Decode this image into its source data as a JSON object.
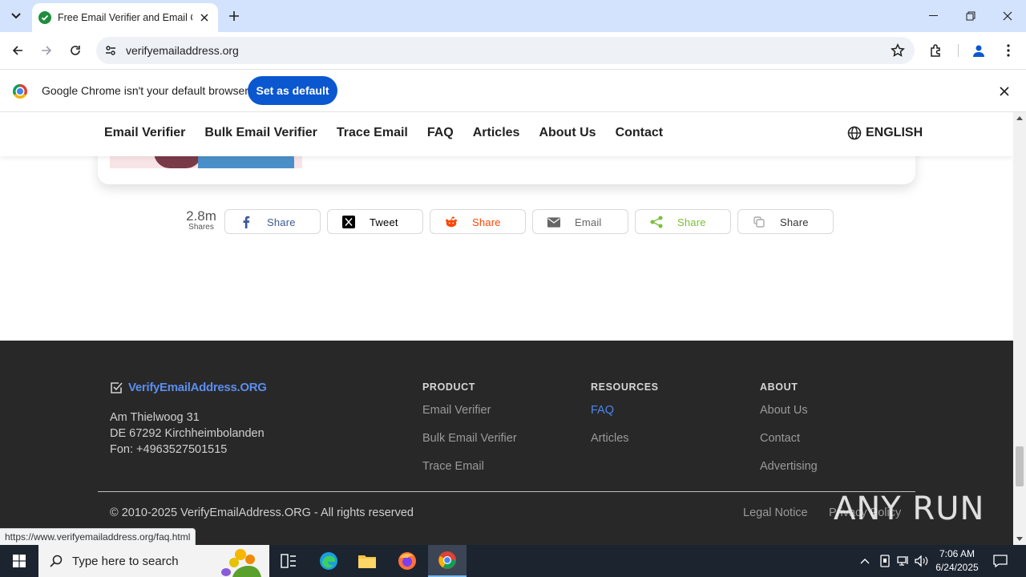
{
  "browser": {
    "tab_title": "Free Email Verifier and Email Ch",
    "url": "verifyemailaddress.org",
    "status_url": "https://www.verifyemailaddress.org/faq.html"
  },
  "infobar": {
    "message": "Google Chrome isn't your default browser",
    "button": "Set as default"
  },
  "nav": {
    "items": [
      "Email Verifier",
      "Bulk Email Verifier",
      "Trace Email",
      "FAQ",
      "Articles",
      "About Us",
      "Contact"
    ],
    "language": "ENGLISH"
  },
  "share": {
    "count": "2.8m",
    "caption": "Shares",
    "buttons": [
      {
        "label": "Share",
        "icon": "facebook-icon",
        "color": "#3b5998"
      },
      {
        "label": "Tweet",
        "icon": "x-icon",
        "color": "#000000"
      },
      {
        "label": "Share",
        "icon": "reddit-icon",
        "color": "#ff4500"
      },
      {
        "label": "Email",
        "icon": "email-icon",
        "color": "#666666"
      },
      {
        "label": "Share",
        "icon": "share-icon",
        "color": "#7bbf3a"
      },
      {
        "label": "Share",
        "icon": "copy-icon",
        "color": "#aaaaaa"
      }
    ]
  },
  "footer": {
    "brand": "VerifyEmailAddress.ORG",
    "address": [
      "Am Thielwoog 31",
      "DE 67292 Kirchheimbolanden",
      "Fon: +4963527501515"
    ],
    "columns": [
      {
        "heading": "PRODUCT",
        "links": [
          "Email Verifier",
          "Bulk Email Verifier",
          "Trace Email"
        ]
      },
      {
        "heading": "RESOURCES",
        "links": [
          "FAQ",
          "Articles"
        ]
      },
      {
        "heading": "ABOUT",
        "links": [
          "About Us",
          "Contact",
          "Advertising"
        ]
      }
    ],
    "copyright": "© 2010-2025 VerifyEmailAddress.ORG - All rights reserved",
    "legal": "Legal Notice",
    "privacy": "Privacy Policy"
  },
  "watermark": "ANY RUN",
  "taskbar": {
    "search_placeholder": "Type here to search",
    "time": "7:06 AM",
    "date": "6/24/2025"
  },
  "colors": {
    "tabstrip": "#d3e3fd",
    "accent_button": "#0b57d0",
    "footer_bg": "#282828",
    "brand_blue": "#5b8def",
    "active_link": "#4b86f0"
  }
}
